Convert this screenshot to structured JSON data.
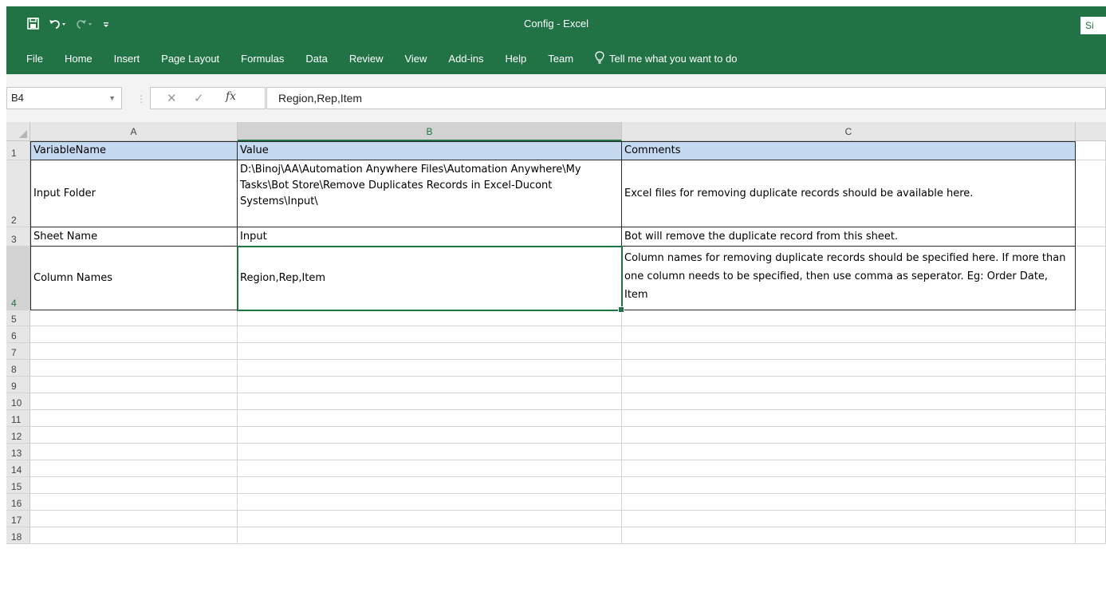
{
  "window": {
    "title": "Config  -  Excel",
    "signin_label": "Si"
  },
  "quick_access": {
    "save_icon": "save-icon",
    "undo_icon": "undo-icon",
    "redo_icon": "redo-icon",
    "customize_icon": "customize-qat-icon"
  },
  "ribbon": {
    "tabs": [
      "File",
      "Home",
      "Insert",
      "Page Layout",
      "Formulas",
      "Data",
      "Review",
      "View",
      "Add-ins",
      "Help",
      "Team"
    ],
    "tell_me": "Tell me what you want to do"
  },
  "formula_bar": {
    "name_box": "B4",
    "fx": "fx",
    "value": "Region,Rep,Item"
  },
  "sheet": {
    "columns": [
      "A",
      "B",
      "C"
    ],
    "rows": [
      "1",
      "2",
      "3",
      "4",
      "5",
      "6",
      "7",
      "8",
      "9",
      "10",
      "11",
      "12",
      "13",
      "14",
      "15",
      "16",
      "17",
      "18"
    ],
    "cells": {
      "A1": "VariableName",
      "B1": "Value",
      "C1": "Comments",
      "A2": "Input Folder",
      "B2": "D:\\Binoj\\AA\\Automation Anywhere Files\\Automation Anywhere\\My Tasks\\Bot Store\\Remove Duplicates Records in Excel-Ducont Systems\\Input\\",
      "C2": "Excel files for removing duplicate records should be available here.",
      "A3": "Sheet Name",
      "B3": "Input",
      "C3": "Bot will remove the duplicate record from this sheet.",
      "A4": "Column Names",
      "B4": "Region,Rep,Item",
      "C4": "Column names for removing duplicate records should be specified here. If more than one column needs to be specified, then use comma as seperator. Eg: Order Date, Item"
    },
    "selected_cell": "B4",
    "header_fill": "#c5d9f1",
    "accent": "#217346"
  }
}
